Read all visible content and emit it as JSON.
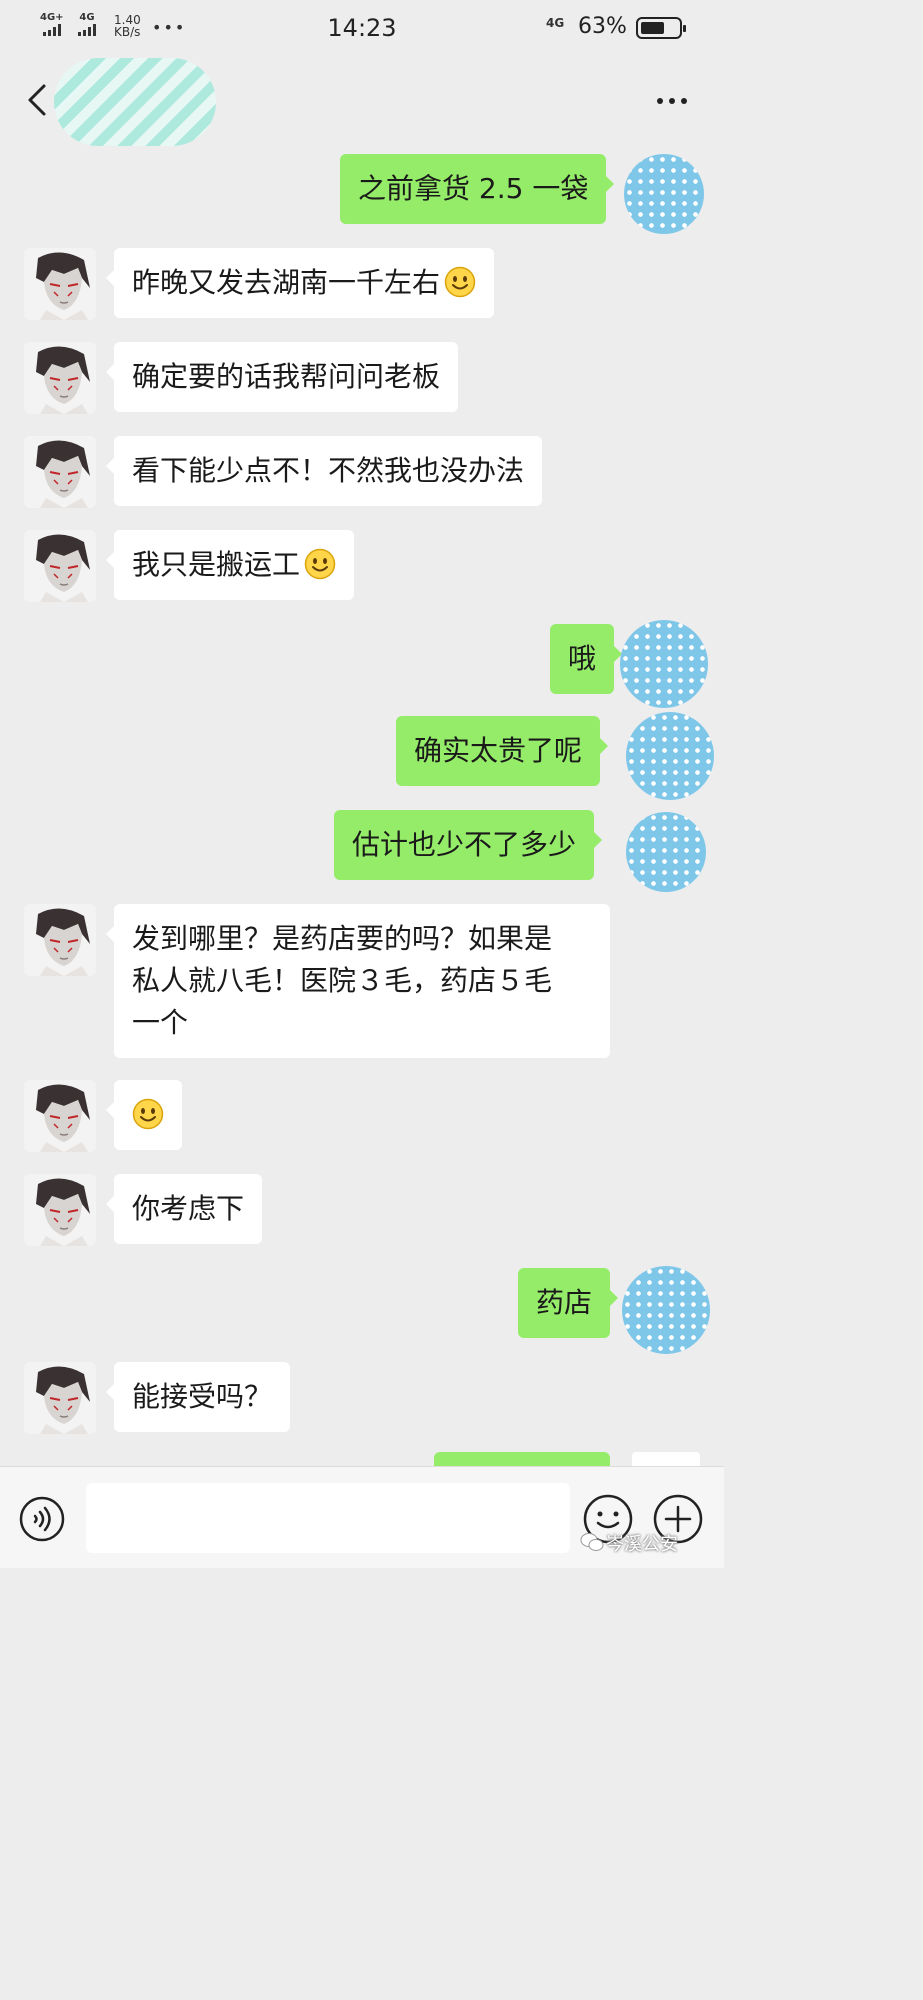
{
  "status_bar": {
    "signal_1_label": "4G+",
    "signal_2_label": "4G",
    "speed_value": "1.40",
    "speed_unit": "KB/s",
    "dots": "•••",
    "time": "14:23",
    "network_right": "4G",
    "battery_text": "63%",
    "battery_level": 0.63
  },
  "header": {
    "contact_name_redacted": true,
    "more_icon": "more-horizontal-icon",
    "back_icon": "chevron-left-icon"
  },
  "messages": [
    {
      "side": "me",
      "text": "之前拿货 2.5 一袋"
    },
    {
      "side": "them",
      "text": "昨晚又发去湖南一千左右",
      "emoji": "smile"
    },
    {
      "side": "them",
      "text": "确定要的话我帮问问老板"
    },
    {
      "side": "them",
      "text": "看下能少点不！不然我也没办法"
    },
    {
      "side": "them",
      "text": "我只是搬运工",
      "emoji": "smile"
    },
    {
      "side": "me",
      "text": "哦"
    },
    {
      "side": "me",
      "text": "确实太贵了呢"
    },
    {
      "side": "me",
      "text": "估计也少不了多少"
    },
    {
      "side": "them",
      "lines": [
        "发到哪里？是药店要的吗？如果是",
        "私人就八毛！医院３毛，药店５毛",
        "一个"
      ]
    },
    {
      "side": "them",
      "text": "",
      "emoji": "smile"
    },
    {
      "side": "them",
      "text": "你考虑下"
    },
    {
      "side": "me",
      "text": "药店"
    },
    {
      "side": "them",
      "text": "能接受吗？"
    }
  ],
  "bottom_bar": {
    "voice_icon": "voice-icon",
    "emoji_icon": "emoji-icon",
    "plus_icon": "plus-icon",
    "input_value": ""
  },
  "watermark": {
    "text": "岑溪公安"
  },
  "colors": {
    "background": "#ededed",
    "my_bubble": "#95ec69",
    "their_bubble": "#ffffff"
  }
}
